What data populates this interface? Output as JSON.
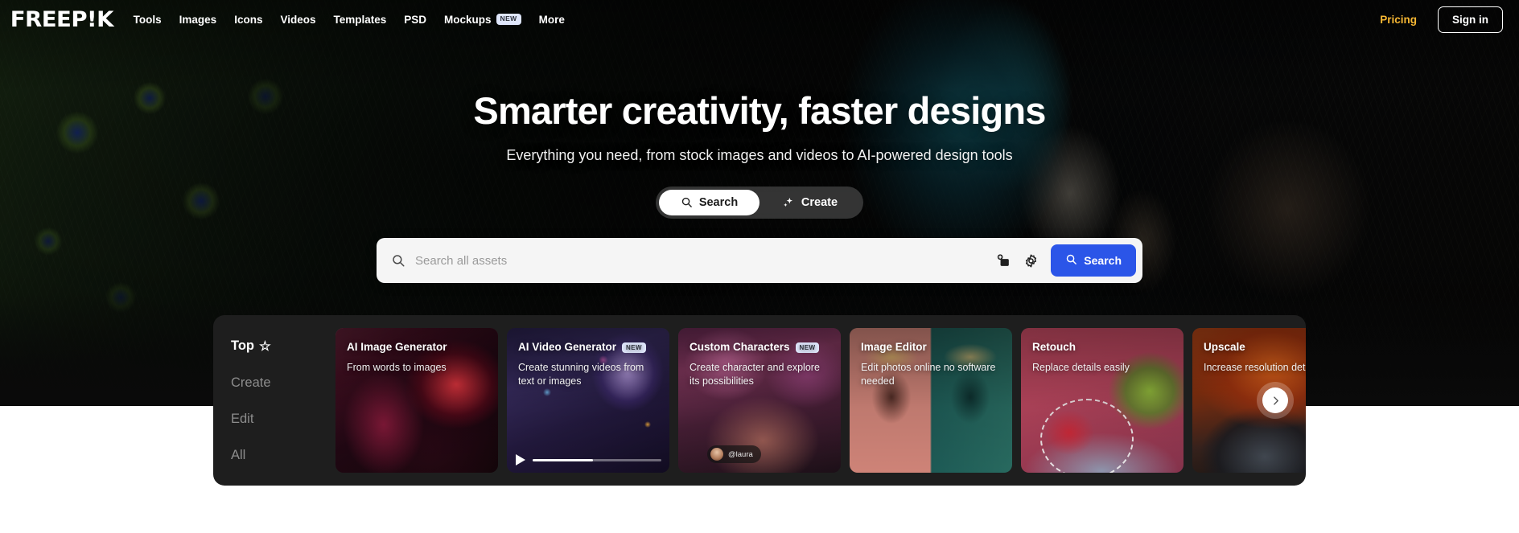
{
  "brand": {
    "logo": "FREEP!K",
    "accent_pricing": "#f7b733",
    "accent_button": "#2b55e8"
  },
  "topnav": {
    "items": [
      {
        "label": "Tools",
        "badge": ""
      },
      {
        "label": "Images",
        "badge": ""
      },
      {
        "label": "Icons",
        "badge": ""
      },
      {
        "label": "Videos",
        "badge": ""
      },
      {
        "label": "Templates",
        "badge": ""
      },
      {
        "label": "PSD",
        "badge": ""
      },
      {
        "label": "Mockups",
        "badge": "NEW"
      },
      {
        "label": "More",
        "badge": ""
      }
    ],
    "pricing": "Pricing",
    "signin": "Sign in"
  },
  "hero": {
    "title": "Smarter creativity, faster designs",
    "subtitle": "Everything you need, from stock images and videos to AI-powered design tools"
  },
  "mode_toggle": {
    "search_label": "Search",
    "create_label": "Create",
    "active": "Search"
  },
  "search": {
    "placeholder": "Search all assets",
    "value": "",
    "button_label": "Search",
    "image_search_icon": "add-image-icon",
    "settings_icon": "gear-icon"
  },
  "carousel": {
    "categories": [
      {
        "label": "Top",
        "star": "☆",
        "active": true
      },
      {
        "label": "Create",
        "star": "",
        "active": false
      },
      {
        "label": "Edit",
        "star": "",
        "active": false
      },
      {
        "label": "All",
        "star": "",
        "active": false
      }
    ],
    "cards": [
      {
        "title": "AI Image Generator",
        "badge": "",
        "subtitle": "From words to images",
        "art": "art-aiimg",
        "video": false,
        "watermark": ""
      },
      {
        "title": "AI Video Generator",
        "badge": "NEW",
        "subtitle": "Create stunning videos from text or images",
        "art": "art-aivid",
        "video": true,
        "watermark": ""
      },
      {
        "title": "Custom Characters",
        "badge": "NEW",
        "subtitle": "Create character and explore its possibilities",
        "art": "art-char",
        "video": false,
        "watermark": "@laura"
      },
      {
        "title": "Image Editor",
        "badge": "",
        "subtitle": "Edit photos online no software needed",
        "art": "art-edit",
        "video": false,
        "watermark": ""
      },
      {
        "title": "Retouch",
        "badge": "",
        "subtitle": "Replace details easily",
        "art": "art-retouch",
        "video": false,
        "watermark": ""
      },
      {
        "title": "Upscale",
        "badge": "",
        "subtitle": "Increase resolution details",
        "art": "art-upscale",
        "video": false,
        "watermark": ""
      }
    ],
    "next_label": "›"
  }
}
